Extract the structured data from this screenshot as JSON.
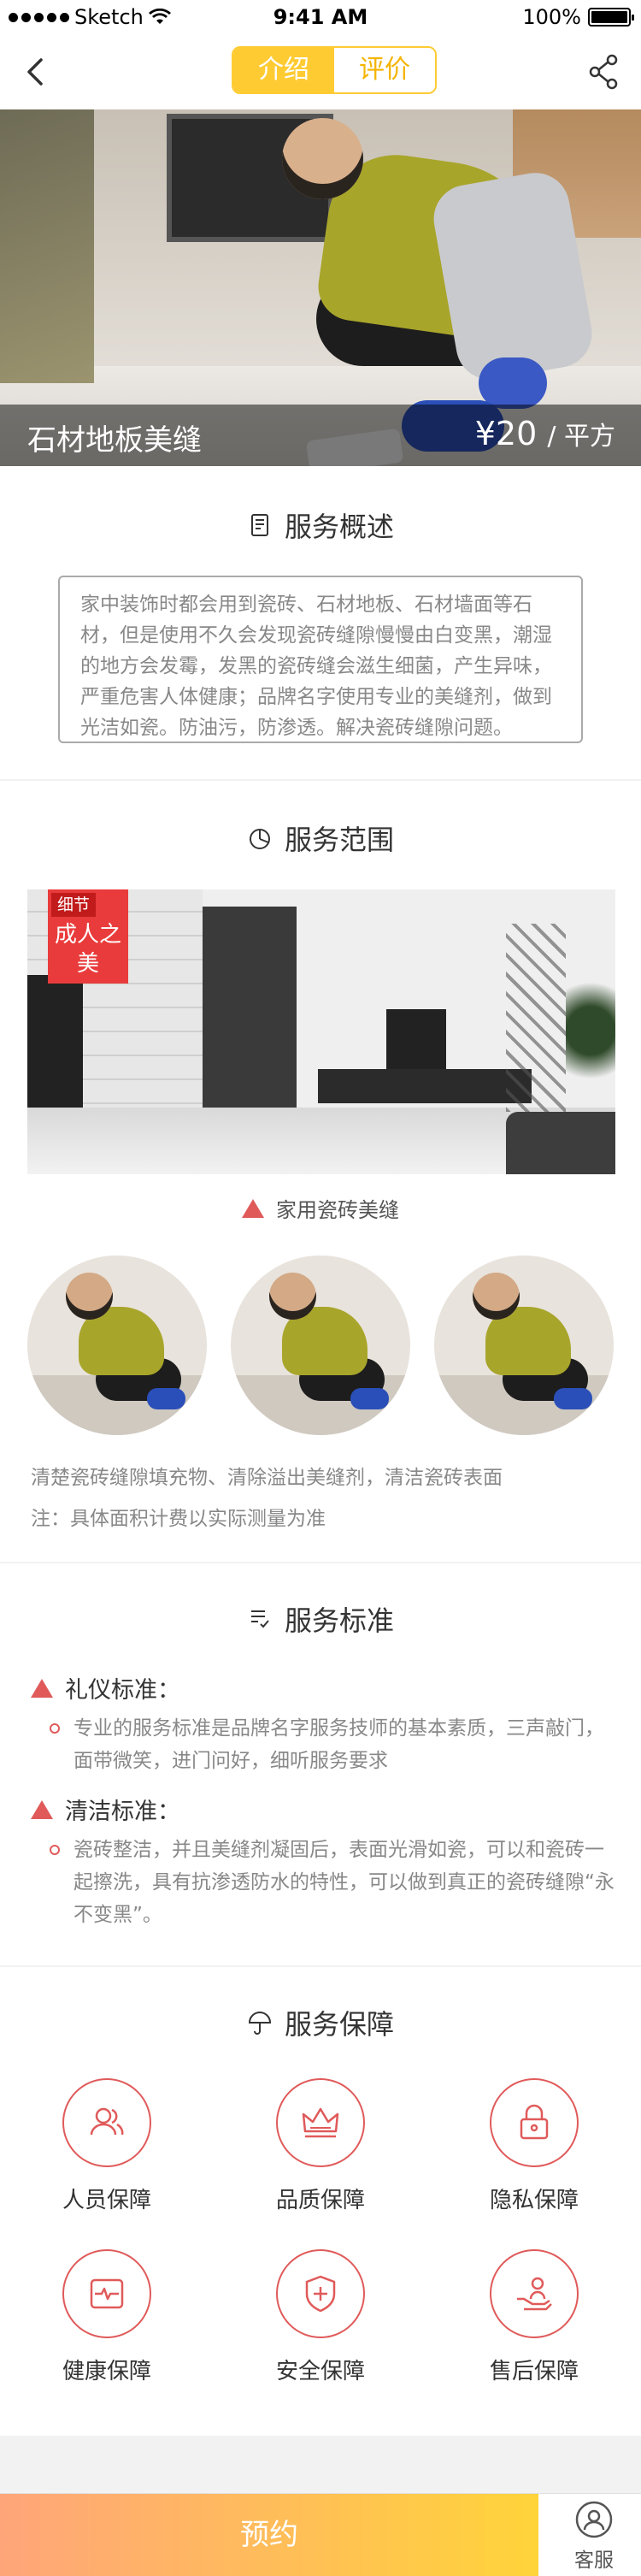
{
  "status_bar": {
    "carrier": "Sketch",
    "time": "9:41 AM",
    "battery": "100%"
  },
  "nav": {
    "tabs": [
      {
        "label": "介绍",
        "active": true
      },
      {
        "label": "评价",
        "active": false
      }
    ]
  },
  "hero": {
    "title": "石材地板美缝",
    "price": "¥20",
    "unit": "/ 平方"
  },
  "overview": {
    "title": "服务概述",
    "text": "家中装饰时都会用到瓷砖、石材地板、石材墙面等石材，但是使用不久会发现瓷砖缝隙慢慢由白变黑，潮湿的地方会发霉，发黑的瓷砖缝会滋生细菌，产生异味，严重危害人体健康；品牌名字使用专业的美缝剂，做到光洁如瓷。防油污，防渗透。解决瓷砖缝隙问题。"
  },
  "scope": {
    "title": "服务范围",
    "tag_small": "细节",
    "tag_big": "成人之美",
    "subtitle": "家用瓷砖美缝",
    "description": "清楚瓷砖缝隙填充物、清除溢出美缝剂，清洁瓷砖表面",
    "note": "注：具体面积计费以实际测量为准"
  },
  "standard": {
    "title": "服务标准",
    "items": [
      {
        "heading": "礼仪标准：",
        "text": "专业的服务标准是品牌名字服务技师的基本素质，三声敲门，面带微笑，进门问好，细听服务要求"
      },
      {
        "heading": "清洁标准：",
        "text": "瓷砖整洁，并且美缝剂凝固后，表面光滑如瓷，可以和瓷砖一起擦洗，具有抗渗透防水的特性，可以做到真正的瓷砖缝隙“永不变黑”。"
      }
    ]
  },
  "guarantee": {
    "title": "服务保障",
    "items": [
      {
        "label": "人员保障",
        "icon": "people-icon"
      },
      {
        "label": "品质保障",
        "icon": "crown-icon"
      },
      {
        "label": "隐私保障",
        "icon": "lock-icon"
      },
      {
        "label": "健康保障",
        "icon": "health-icon"
      },
      {
        "label": "安全保障",
        "icon": "shield-icon"
      },
      {
        "label": "售后保障",
        "icon": "after-sale-icon"
      }
    ]
  },
  "bottom": {
    "book_label": "预约",
    "service_label": "客服"
  },
  "colors": {
    "accent_yellow": "#ffcb33",
    "accent_red": "#e05a5a",
    "gradient_start": "#ffa57a",
    "gradient_end": "#ffd43a"
  }
}
